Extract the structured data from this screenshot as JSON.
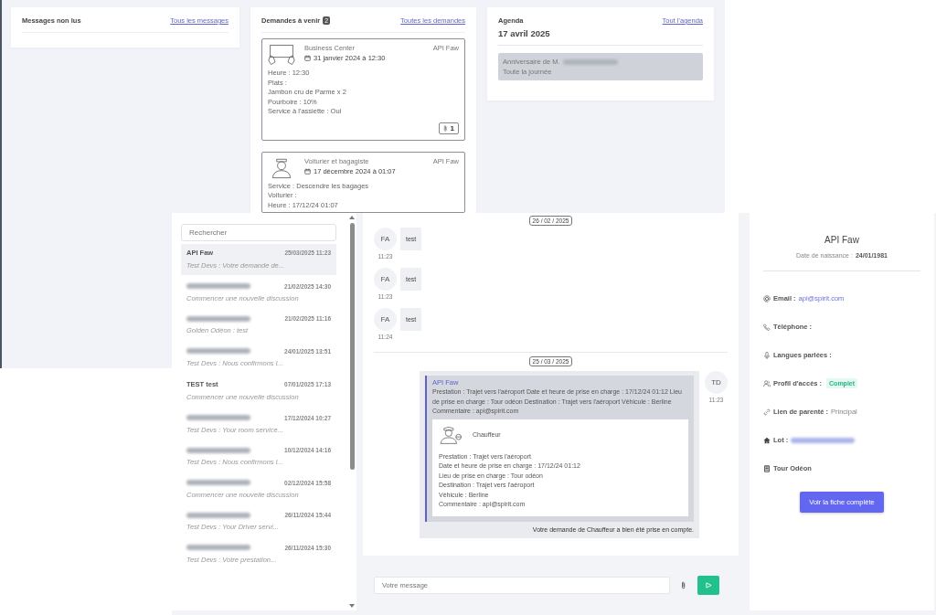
{
  "dashboard": {
    "unread_messages": {
      "title": "Messages non lus",
      "link": "Tous les messages"
    },
    "upcoming_requests": {
      "title": "Demandes à venir",
      "count": "2",
      "link": "Toutes les demandes",
      "requests": [
        {
          "kind": "business",
          "service": "Business Center",
          "date": "31 janvier 2024 à 12:30",
          "client": "API Faw",
          "details": [
            "Heure : 12:30",
            "Plats :",
            "Jambon cru de Parme x 2",
            "Pourboire : 10%",
            "Service à l'assiette : Oui"
          ],
          "attachments": "1"
        },
        {
          "kind": "valet",
          "service": "Voiturier et bagagiste",
          "date": "17 décembre 2024 à 01:07",
          "client": "API Faw",
          "details": [
            "Service : Descendre les bagages",
            "Voiturier :",
            "Heure : 17/12/24 01:07"
          ]
        }
      ]
    },
    "agenda": {
      "title": "Agenda",
      "link": "Tout l'agenda",
      "date": "17 avril 2025",
      "events": [
        {
          "title": "Anniversaire de M.",
          "name_blurred": true,
          "time": "Toute la journée"
        }
      ]
    }
  },
  "messaging": {
    "search": {
      "placeholder": "Rechercher"
    },
    "conversations": [
      {
        "name": "API Faw",
        "date": "25/03/2025 11:23",
        "preview": "Test Devs : Votre demande de...",
        "selected": true
      },
      {
        "date": "21/02/2025 14:30",
        "preview": "Commencer une nouvelle discussion",
        "selected": false
      },
      {
        "date": "21/02/2025 11:16",
        "preview": "Golden Odéon : test",
        "selected": false
      },
      {
        "date": "24/01/2025 13:51",
        "preview": "Test Devs : Nous confirmons l...",
        "selected": false
      },
      {
        "name": "TEST test",
        "date": "07/01/2025 17:13",
        "preview": "Commencer une nouvelle discussion",
        "selected": false
      },
      {
        "date": "17/12/2024 10:27",
        "preview": "Test Devs : Your room service...",
        "selected": false
      },
      {
        "date": "10/12/2024 14:16",
        "preview": "Test Devs : Nous confirmons l...",
        "selected": false
      },
      {
        "date": "02/12/2024 15:58",
        "preview": "Commencer une nouvelle discussion",
        "selected": false
      },
      {
        "date": "26/11/2024 15:44",
        "preview": "Test Devs : Your Driver servi...",
        "selected": false
      },
      {
        "date": "26/11/2024 15:30",
        "preview": "Test Devs : Votre prestation...",
        "selected": false
      }
    ],
    "thread": {
      "days": [
        {
          "date": "26 / 02 / 2025",
          "messages": [
            {
              "kind": "incoming",
              "avatar": "FA",
              "text": "test",
              "time": "11:23"
            },
            {
              "kind": "incoming",
              "avatar": "FA",
              "text": "test",
              "time": "11:23"
            },
            {
              "kind": "incoming",
              "avatar": "FA",
              "text": "test",
              "time": "11:24"
            }
          ]
        },
        {
          "date": "25 / 03 / 2025",
          "messages": [
            {
              "kind": "request",
              "avatar": "TD",
              "time": "11:23",
              "quote_author": "API Faw",
              "quote_text": "Prestation : Trajet vers l'aéroport Date et heure de prise en charge : 17/12/24 01:12 Lieu de prise en charge : Tour odéon Destination : Trajet vers l'aéroport Véhicule : Berline Commentaire : api@spirit.com",
              "card": {
                "service": "Chauffeur",
                "lines": [
                  "Prestation : Trajet vers l'aéroport",
                  "Date et heure de prise en charge : 17/12/24 01:12",
                  "Lieu de prise en charge : Tour odéon",
                  "Destination : Trajet vers l'aéroport",
                  "Véhicule : Berline",
                  "Commentaire : api@spirit.com"
                ]
              },
              "text": "Votre demande de Chauffeur a bien été prise en compte."
            }
          ]
        }
      ]
    },
    "composer": {
      "placeholder": "Votre message"
    }
  },
  "profile": {
    "name": "API Faw",
    "birth_label": "Date de naissance :",
    "birth_date": "24/01/1981",
    "fields": [
      {
        "kind": "email",
        "label": "Email :",
        "value": "api@spirit.com",
        "link": true
      },
      {
        "kind": "phone",
        "label": "Téléphone :"
      },
      {
        "kind": "languages",
        "label": "Langues parlées :"
      },
      {
        "kind": "access",
        "label": "Profil d'accès :",
        "badge": "Complet"
      },
      {
        "kind": "relation",
        "label": "Lien de parenté :",
        "value": "Principal",
        "link": false
      },
      {
        "kind": "lot",
        "label": "Lot :",
        "value_blurred": true
      },
      {
        "kind": "building",
        "label": "Tour Odéon"
      }
    ],
    "button": "Voir la fiche complète"
  }
}
